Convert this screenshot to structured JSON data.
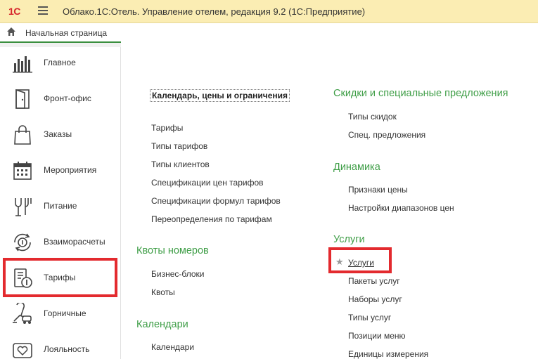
{
  "app": {
    "logo": "1С",
    "title": "Облако.1С:Отель. Управление отелем, редакция 9.2  (1С:Предприятие)"
  },
  "home_tab": {
    "label": "Начальная страница"
  },
  "sidebar": {
    "items": [
      {
        "label": "Главное",
        "icon": "chart-bars-icon"
      },
      {
        "label": "Фронт-офис",
        "icon": "door-icon"
      },
      {
        "label": "Заказы",
        "icon": "shopping-bag-icon"
      },
      {
        "label": "Мероприятия",
        "icon": "calendar-icon"
      },
      {
        "label": "Питание",
        "icon": "fork-glass-icon"
      },
      {
        "label": "Взаиморасчеты",
        "icon": "exchange-icon"
      },
      {
        "label": "Тарифы",
        "icon": "tariff-icon"
      },
      {
        "label": "Горничные",
        "icon": "vacuum-icon"
      },
      {
        "label": "Лояльность",
        "icon": "heart-card-icon"
      }
    ]
  },
  "content": {
    "left_column": {
      "calendar_prices": {
        "heading": "Календарь, цены и ограничения",
        "links": [
          "Тарифы",
          "Типы тарифов",
          "Типы клиентов",
          "Спецификации цен тарифов",
          "Спецификации формул тарифов",
          "Переопределения по тарифам"
        ]
      },
      "room_quotas": {
        "heading": "Квоты номеров",
        "links": [
          "Бизнес-блоки",
          "Квоты"
        ]
      },
      "calendars": {
        "heading": "Календари",
        "links": [
          "Календари"
        ]
      }
    },
    "right_column": {
      "discounts": {
        "heading": "Скидки и специальные предложения",
        "links": [
          "Типы скидок",
          "Спец. предложения"
        ]
      },
      "dynamics": {
        "heading": "Динамика",
        "links": [
          "Признаки цены",
          "Настройки диапазонов цен"
        ]
      },
      "services": {
        "heading": "Услуги",
        "starred_link": "Услуги",
        "links": [
          "Пакеты услуг",
          "Наборы услуг",
          "Типы услуг",
          "Позиции меню",
          "Единицы измерения"
        ]
      }
    }
  },
  "colors": {
    "titlebar_bg": "#fbedb3",
    "section_green": "#3f9e47",
    "highlight_red": "#e32a2e",
    "logo_red": "#d6232b"
  }
}
